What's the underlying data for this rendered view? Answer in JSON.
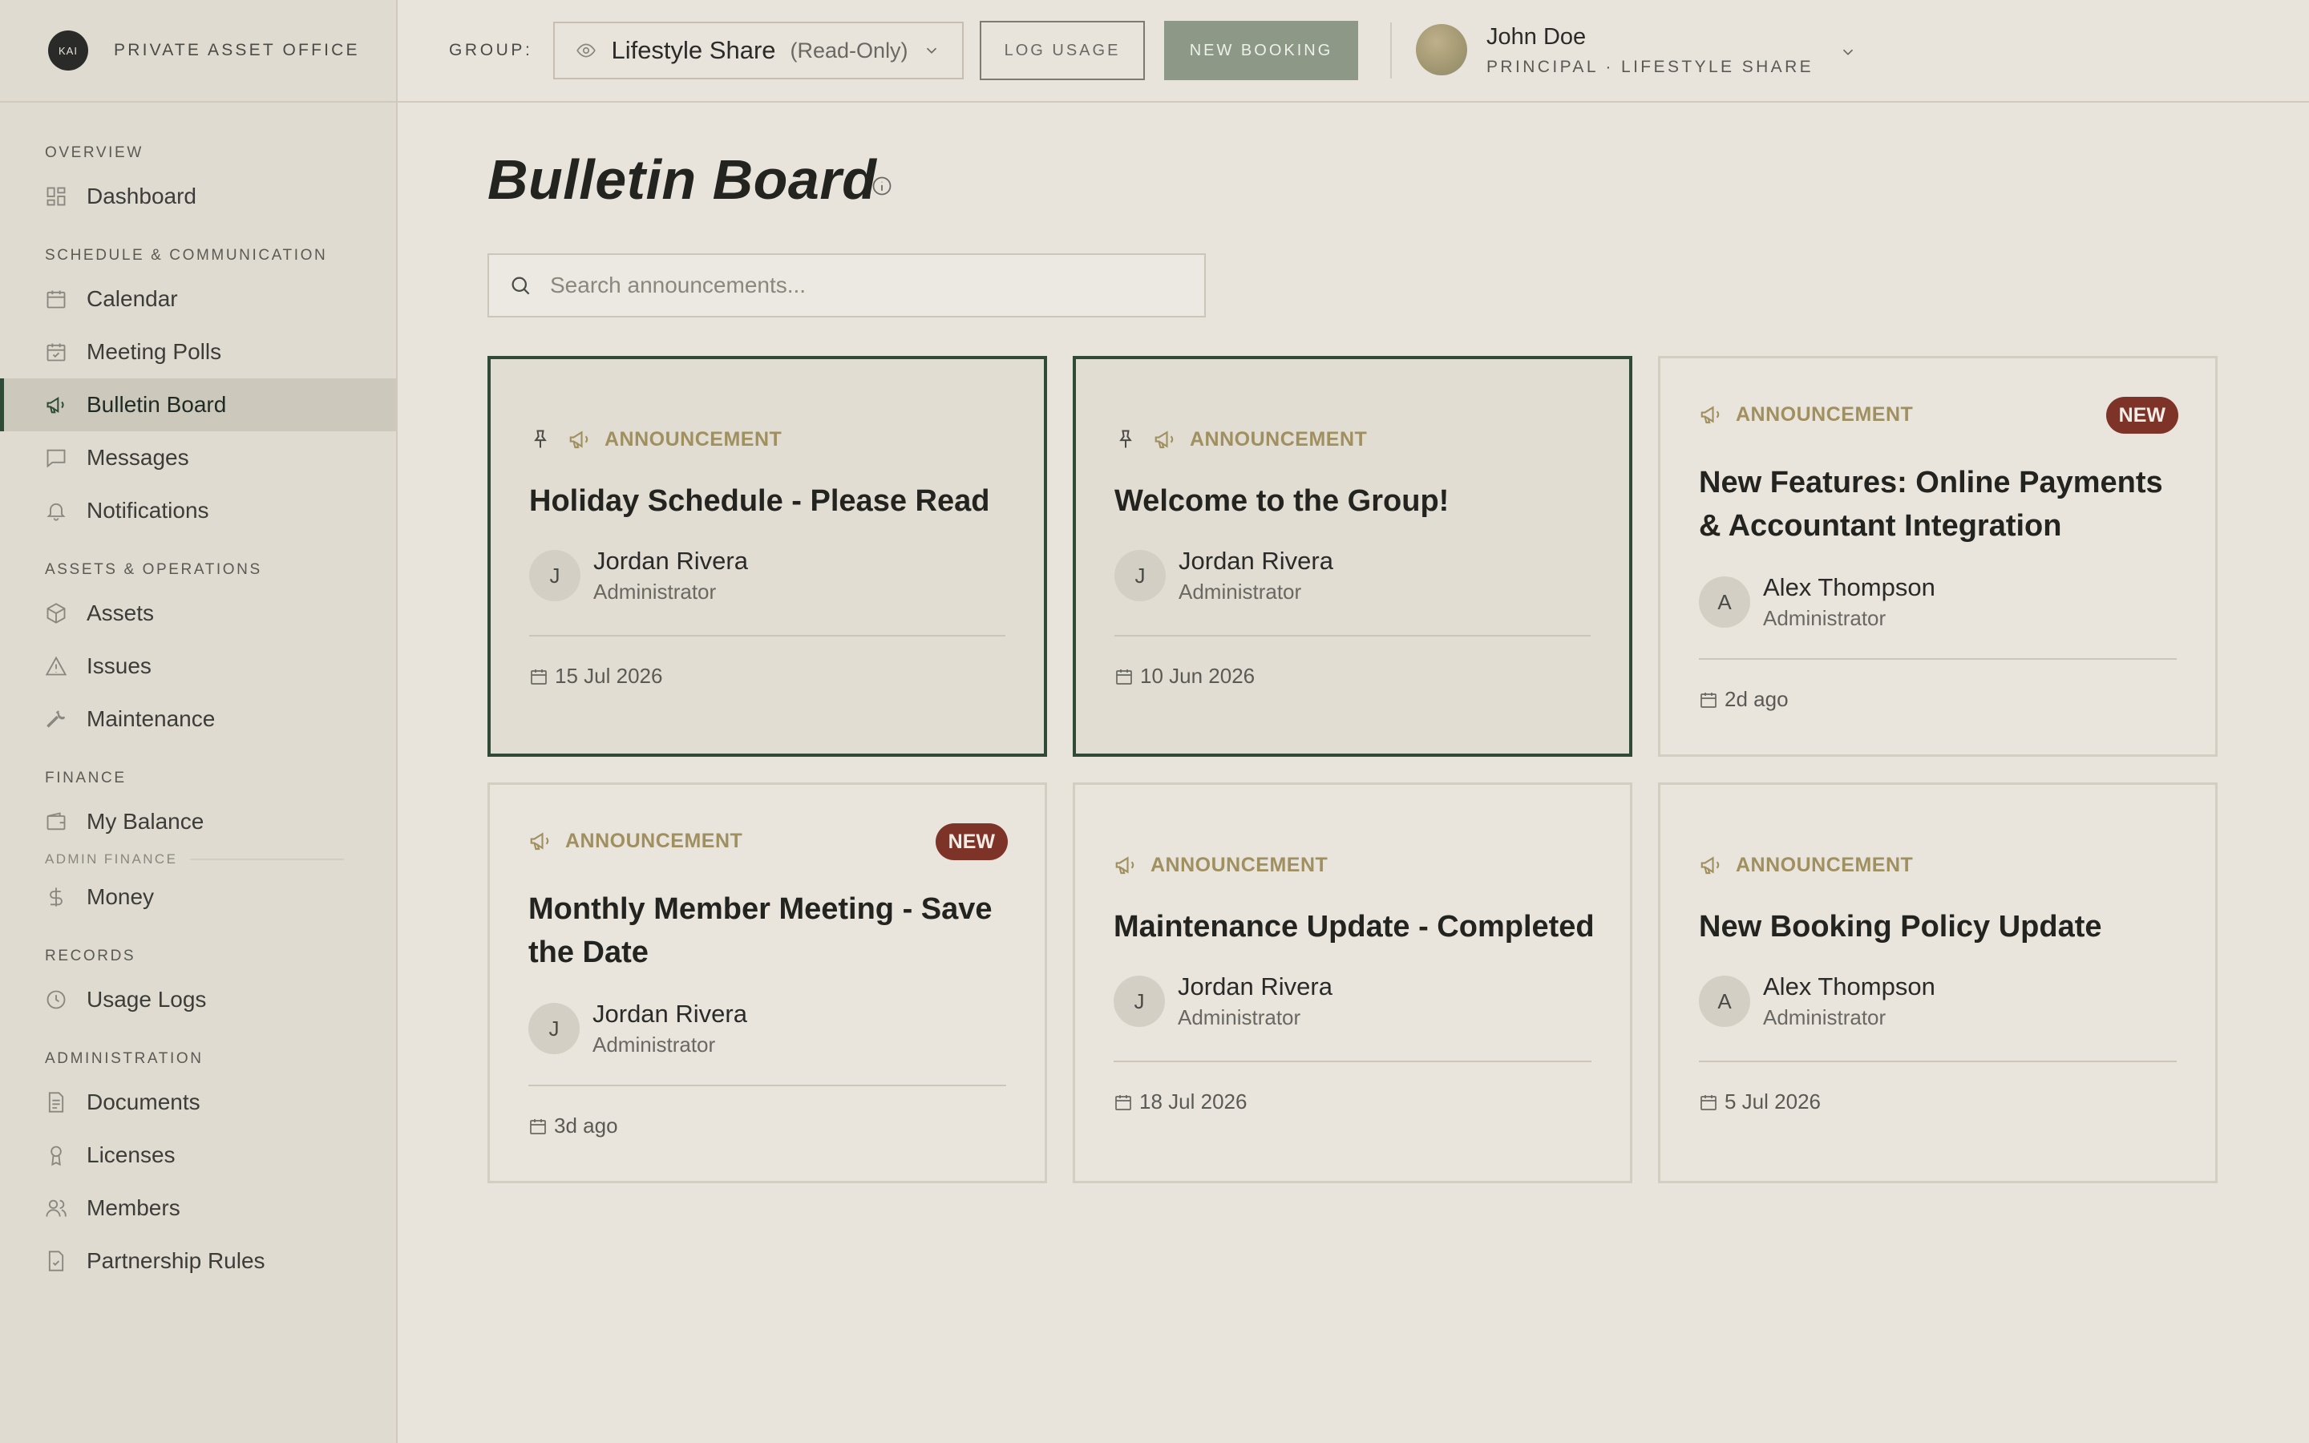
{
  "brand": {
    "logo_text": "KAI",
    "name": "PRIVATE ASSET OFFICE"
  },
  "sidebar": {
    "sections": [
      {
        "title": "OVERVIEW",
        "items": [
          {
            "label": "Dashboard",
            "icon": "dashboard-icon"
          }
        ]
      },
      {
        "title": "SCHEDULE & COMMUNICATION",
        "items": [
          {
            "label": "Calendar",
            "icon": "calendar-icon"
          },
          {
            "label": "Meeting Polls",
            "icon": "calendar-check-icon"
          },
          {
            "label": "Bulletin Board",
            "icon": "megaphone-icon",
            "active": true
          },
          {
            "label": "Messages",
            "icon": "message-icon"
          },
          {
            "label": "Notifications",
            "icon": "bell-icon"
          }
        ]
      },
      {
        "title": "ASSETS & OPERATIONS",
        "items": [
          {
            "label": "Assets",
            "icon": "box-icon"
          },
          {
            "label": "Issues",
            "icon": "warning-icon"
          },
          {
            "label": "Maintenance",
            "icon": "wrench-icon"
          }
        ]
      },
      {
        "title": "FINANCE",
        "items": [
          {
            "label": "My Balance",
            "icon": "wallet-icon"
          }
        ],
        "subtitle": "ADMIN FINANCE",
        "sub_items": [
          {
            "label": "Money",
            "icon": "dollar-icon"
          }
        ]
      },
      {
        "title": "RECORDS",
        "items": [
          {
            "label": "Usage Logs",
            "icon": "clock-icon"
          }
        ]
      },
      {
        "title": "ADMINISTRATION",
        "items": [
          {
            "label": "Documents",
            "icon": "document-icon"
          },
          {
            "label": "Licenses",
            "icon": "ribbon-icon"
          },
          {
            "label": "Members",
            "icon": "users-icon"
          },
          {
            "label": "Partnership Rules",
            "icon": "file-check-icon"
          }
        ]
      }
    ]
  },
  "header": {
    "group_label": "GROUP:",
    "group_name": "Lifestyle Share",
    "group_mode": "(Read-Only)",
    "log_usage_label": "LOG USAGE",
    "new_booking_label": "NEW BOOKING",
    "user_name": "John Doe",
    "user_role": "PRINCIPAL · LIFESTYLE SHARE"
  },
  "main": {
    "title": "Bulletin Board",
    "search_placeholder": "Search announcements..."
  },
  "cards": [
    {
      "type": "ANNOUNCEMENT",
      "pinned": true,
      "new": false,
      "title": "Holiday Schedule - Please Read",
      "author_initial": "J",
      "author": "Jordan Rivera",
      "role": "Administrator",
      "date": "15 Jul 2026"
    },
    {
      "type": "ANNOUNCEMENT",
      "pinned": true,
      "new": false,
      "title": "Welcome to the Group!",
      "author_initial": "J",
      "author": "Jordan Rivera",
      "role": "Administrator",
      "date": "10 Jun 2026"
    },
    {
      "type": "ANNOUNCEMENT",
      "pinned": false,
      "new": true,
      "badge": "NEW",
      "title": "New Features: Online Payments & Accountant Integration",
      "author_initial": "A",
      "author": "Alex Thompson",
      "role": "Administrator",
      "date": "2d ago"
    },
    {
      "type": "ANNOUNCEMENT",
      "pinned": false,
      "new": true,
      "badge": "NEW",
      "title": "Monthly Member Meeting - Save the Date",
      "author_initial": "J",
      "author": "Jordan Rivera",
      "role": "Administrator",
      "date": "3d ago"
    },
    {
      "type": "ANNOUNCEMENT",
      "pinned": false,
      "new": false,
      "title": "Maintenance Update - Completed",
      "author_initial": "J",
      "author": "Jordan Rivera",
      "role": "Administrator",
      "date": "18 Jul 2026"
    },
    {
      "type": "ANNOUNCEMENT",
      "pinned": false,
      "new": false,
      "title": "New Booking Policy Update",
      "author_initial": "A",
      "author": "Alex Thompson",
      "role": "Administrator",
      "date": "5 Jul 2026"
    }
  ],
  "colors": {
    "accent": "#2f4a37",
    "announcement": "#a0905f",
    "new_badge": "#7d3328",
    "primary_button": "#8d9887"
  }
}
